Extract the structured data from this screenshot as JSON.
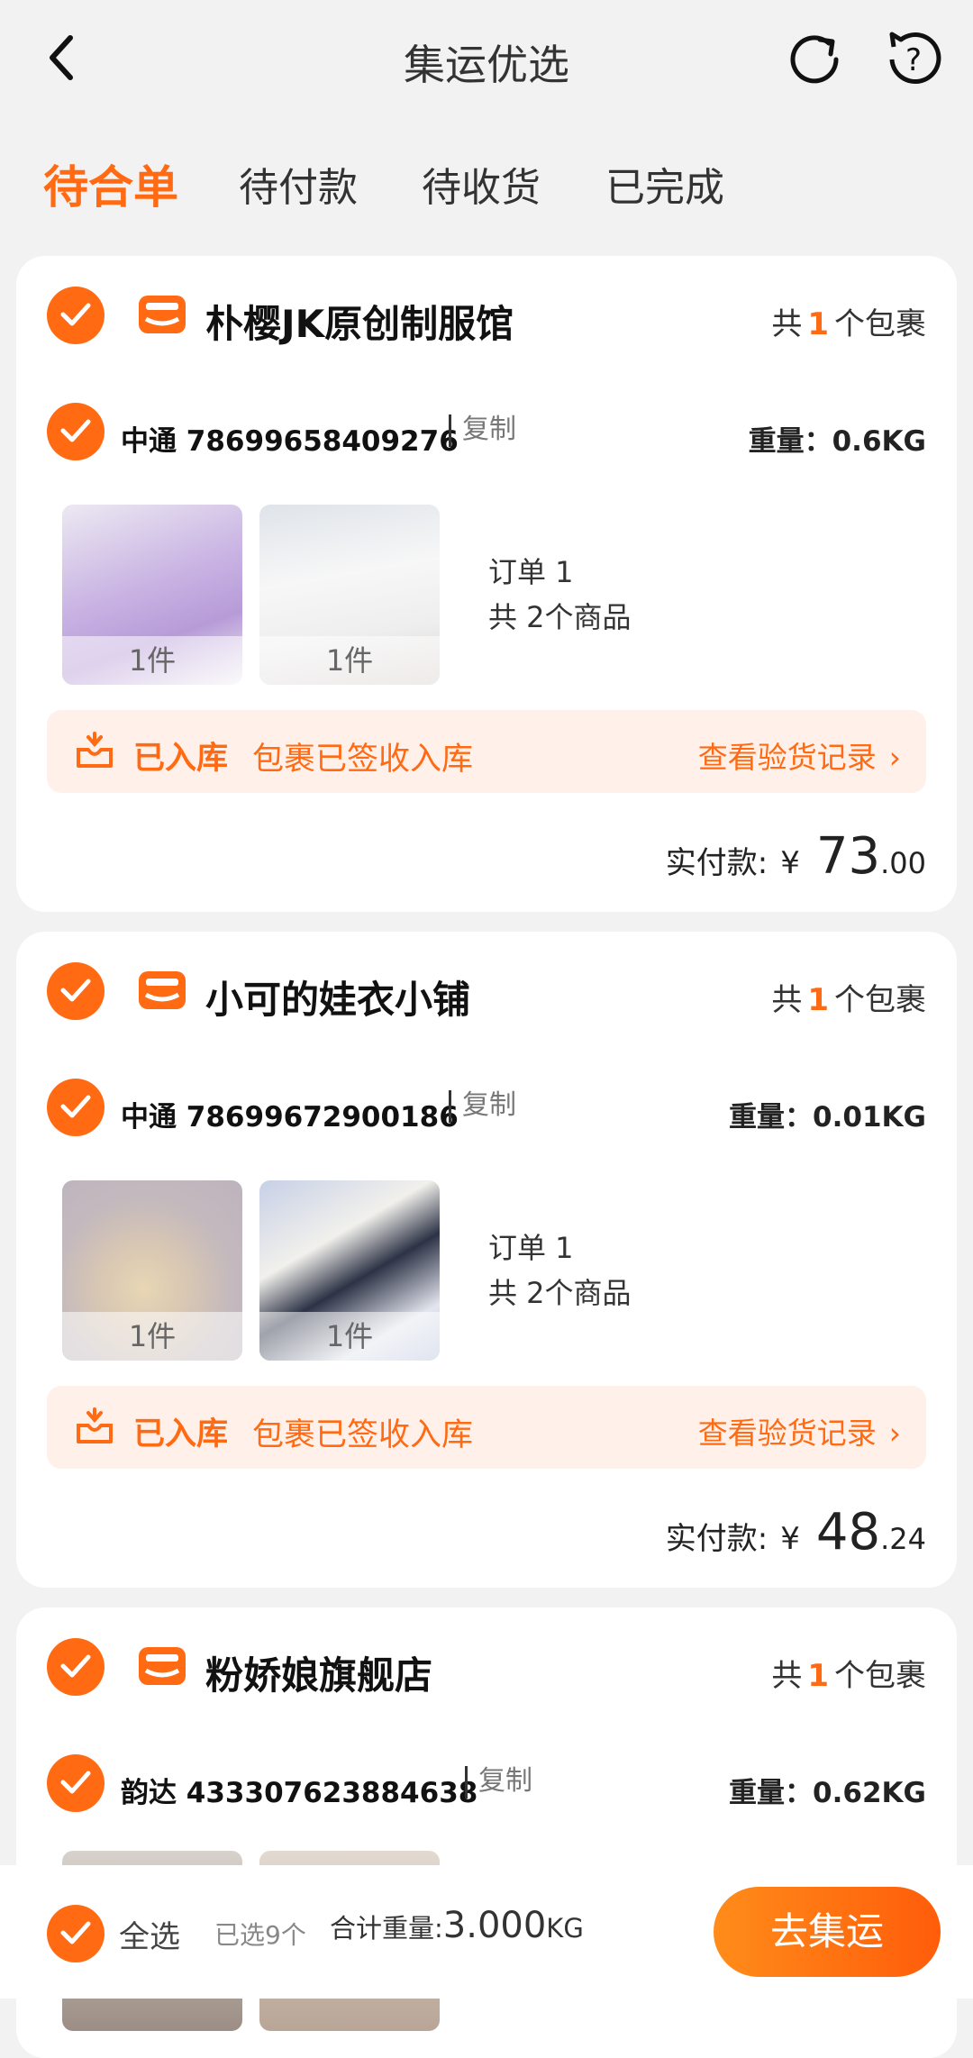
{
  "header": {
    "title": "集运优选"
  },
  "tabs": [
    {
      "label": "待合单"
    },
    {
      "label": "待付款"
    },
    {
      "label": "待收货"
    },
    {
      "label": "已完成"
    }
  ],
  "shops": [
    {
      "name": "朴樱JK原创制服馆",
      "pkg_prefix": "共",
      "pkg_count": "1",
      "pkg_suffix": "个包裹",
      "tracking": "中通 78699658409276",
      "copy": "复制",
      "weight": "重量：0.6KG",
      "thumbs": [
        "1件",
        "1件"
      ],
      "order": "订单 1",
      "items": "共 2个商品",
      "status_label": "已入库",
      "status_desc": "包裹已签收入库",
      "status_link": "查看验货记录",
      "paid_label": "实付款:",
      "yen": "¥",
      "paid_int": "73",
      "paid_dec": ".00"
    },
    {
      "name": "小可的娃衣小铺",
      "pkg_prefix": "共",
      "pkg_count": "1",
      "pkg_suffix": "个包裹",
      "tracking": "中通 78699672900186",
      "copy": "复制",
      "weight": "重量：0.01KG",
      "thumbs": [
        "1件",
        "1件"
      ],
      "order": "订单 1",
      "items": "共 2个商品",
      "status_label": "已入库",
      "status_desc": "包裹已签收入库",
      "status_link": "查看验货记录",
      "paid_label": "实付款:",
      "yen": "¥",
      "paid_int": "48",
      "paid_dec": ".24"
    },
    {
      "name": "粉娇娘旗舰店",
      "pkg_prefix": "共",
      "pkg_count": "1",
      "pkg_suffix": "个包裹",
      "tracking": "韵达 433307623884638",
      "copy": "复制",
      "weight": "重量：0.62KG"
    }
  ],
  "bottom": {
    "select_all": "全选",
    "selected": "已选9个",
    "total_label": "合计重量:",
    "total_value": "3.000",
    "total_unit": "KG",
    "action": "去集运"
  },
  "colors": {
    "accent": "#ff6a13",
    "status_bg": "#fff1ea"
  }
}
